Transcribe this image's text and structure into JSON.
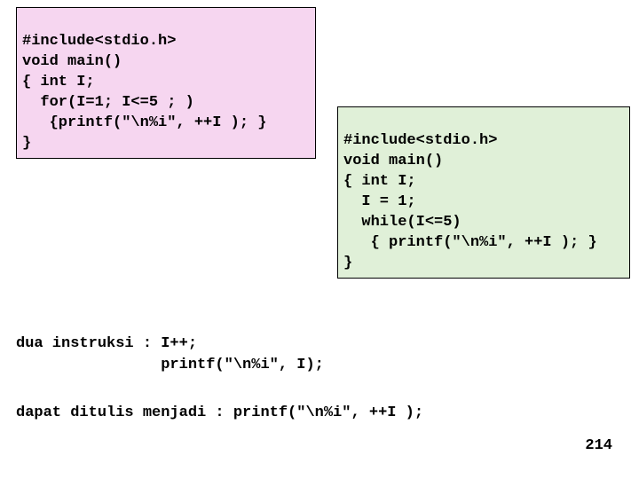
{
  "codebox_left": {
    "l1": "#include<stdio.h>",
    "l2": "void main()",
    "l3": "{ int I;",
    "l4": "  for(I=1; I<=5 ; )",
    "l5": "   {printf(\"\\n%i\", ++I ); }",
    "l6": "}"
  },
  "codebox_right": {
    "l1": "#include<stdio.h>",
    "l2": "void main()",
    "l3": "{ int I;",
    "l4": "  I = 1;",
    "l5": "  while(I<=5)",
    "l6": "   { printf(\"\\n%i\", ++I ); }",
    "l7": "}"
  },
  "explain1": {
    "l1": "dua instruksi : I++;",
    "l2": "                printf(\"\\n%i\", I);"
  },
  "explain2": "dapat ditulis menjadi : printf(\"\\n%i\", ++I );",
  "page_number": "214"
}
